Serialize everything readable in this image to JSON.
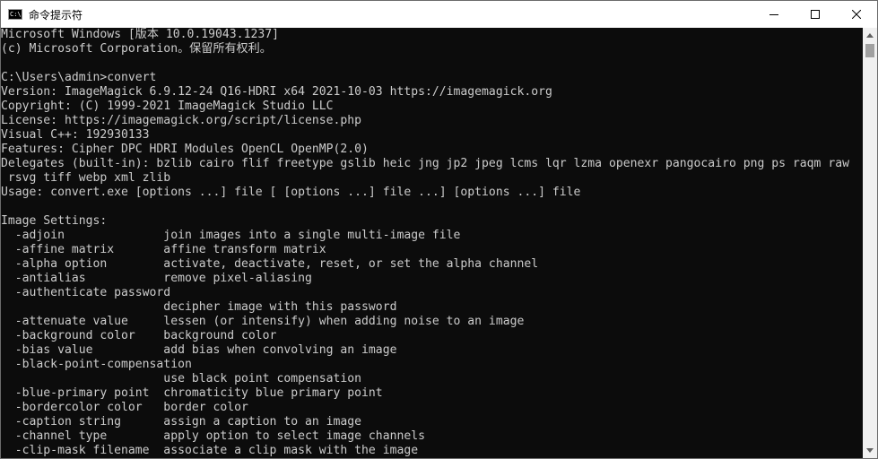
{
  "window": {
    "title": "命令提示符",
    "icon": "cmd-icon",
    "icon_glyph": "C:\\."
  },
  "caption_buttons": [
    {
      "icon": "minimize-icon"
    },
    {
      "icon": "maximize-icon"
    },
    {
      "icon": "close-icon"
    }
  ],
  "console": {
    "lines": [
      "Microsoft Windows [版本 10.0.19043.1237]",
      "(c) Microsoft Corporation。保留所有权利。",
      "",
      "C:\\Users\\admin>convert",
      "Version: ImageMagick 6.9.12-24 Q16-HDRI x64 2021-10-03 https://imagemagick.org",
      "Copyright: (C) 1999-2021 ImageMagick Studio LLC",
      "License: https://imagemagick.org/script/license.php",
      "Visual C++: 192930133",
      "Features: Cipher DPC HDRI Modules OpenCL OpenMP(2.0)",
      "Delegates (built-in): bzlib cairo flif freetype gslib heic jng jp2 jpeg lcms lqr lzma openexr pangocairo png ps raqm raw",
      " rsvg tiff webp xml zlib",
      "Usage: convert.exe [options ...] file [ [options ...] file ...] [options ...] file",
      "",
      "Image Settings:",
      "  -adjoin              join images into a single multi-image file",
      "  -affine matrix       affine transform matrix",
      "  -alpha option        activate, deactivate, reset, or set the alpha channel",
      "  -antialias           remove pixel-aliasing",
      "  -authenticate password",
      "                       decipher image with this password",
      "  -attenuate value     lessen (or intensify) when adding noise to an image",
      "  -background color    background color",
      "  -bias value          add bias when convolving an image",
      "  -black-point-compensation",
      "                       use black point compensation",
      "  -blue-primary point  chromaticity blue primary point",
      "  -bordercolor color   border color",
      "  -caption string      assign a caption to an image",
      "  -channel type        apply option to select image channels",
      "  -clip-mask filename  associate a clip mask with the image"
    ]
  },
  "scrollbar": {
    "up_icon": "scroll-up-arrow-icon",
    "down_icon": "scroll-down-arrow-icon"
  },
  "colors": {
    "console_bg": "#0c0c0c",
    "console_text": "#cccccc",
    "titlebar_bg": "#ffffff",
    "scrollbar_bg": "#f0f0f0",
    "scrollbar_thumb": "#a0a0a0"
  }
}
